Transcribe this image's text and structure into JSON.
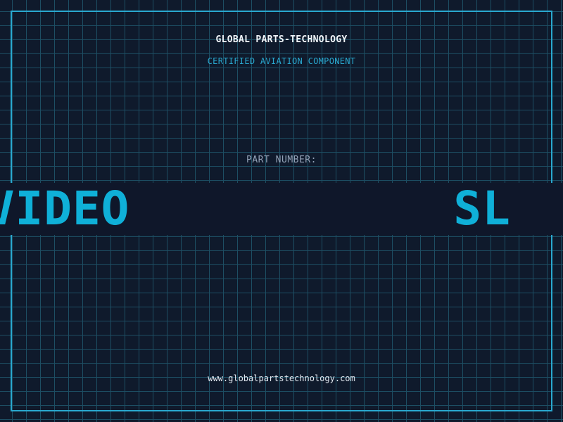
{
  "brand": {
    "name": "GLOBAL PARTS-TECHNOLOGY",
    "tagline": "CERTIFIED AVIATION COMPONENT"
  },
  "part": {
    "label": "PART NUMBER:",
    "ticker_left": "LVIDEO",
    "ticker_right": "SL"
  },
  "footer": {
    "website": "www.globalpartstechnology.com"
  },
  "colors": {
    "background": "#0f172a",
    "accent": "#29a8cf",
    "ticker_text": "#0fb0d8"
  }
}
